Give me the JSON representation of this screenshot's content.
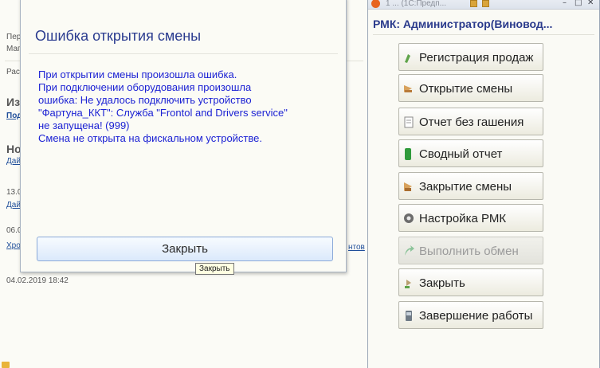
{
  "background": {
    "lines": [
      "Пери",
      "Мага",
      "Расп"
    ],
    "section_izm": "Изм",
    "link_pod": "Под",
    "section_no": "Но",
    "link_day1": "Дай",
    "date1": "13.02",
    "link_day2": "Дай",
    "date2": "06.02",
    "link_hron": "Хрон",
    "link_ntov": "нтов",
    "datetime": "04.02.2019 18:42"
  },
  "dialog": {
    "title": "Ошибка открытия смены",
    "message_lines": [
      "При открытии смены произошла ошибка.",
      "При подключении оборудования произошла",
      "ошибка: Не удалось подключить устройство",
      "\"Фартуна_ККТ\": Служба \"Frontol and Drivers service\"",
      "не запущена! (999)",
      "Смена не открыта на фискальном устройстве."
    ],
    "close_label": "Закрыть",
    "tooltip": "Закрыть"
  },
  "panel": {
    "topbar_text": "1 ... (1С:Предп...",
    "title": "РМК: Администратор(Виновод...",
    "buttons": [
      {
        "label": "Регистрация продаж",
        "icon": "cart-icon",
        "enabled": true
      },
      {
        "label": "Открытие смены",
        "icon": "open-shift-icon",
        "enabled": true
      },
      {
        "label": "Отчет без гашения",
        "icon": "report-icon",
        "enabled": true
      },
      {
        "label": "Сводный отчет",
        "icon": "summary-report-icon",
        "enabled": true
      },
      {
        "label": "Закрытие смены",
        "icon": "close-shift-icon",
        "enabled": true
      },
      {
        "label": "Настройка РМК",
        "icon": "settings-gear-icon",
        "enabled": true
      },
      {
        "label": "Выполнить обмен",
        "icon": "exchange-arrow-icon",
        "enabled": false
      },
      {
        "label": "Закрыть",
        "icon": "close-door-icon",
        "enabled": true
      },
      {
        "label": "Завершение работы",
        "icon": "shutdown-icon",
        "enabled": true
      }
    ]
  }
}
